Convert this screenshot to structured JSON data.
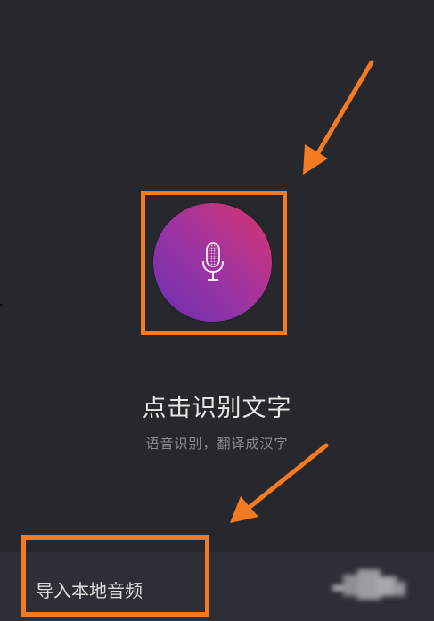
{
  "main": {
    "title": "点击识别文字",
    "subtitle": "语音识别，翻译成汉字"
  },
  "bottom_bar": {
    "import_label": "导入本地音频"
  },
  "icons": {
    "mic": "microphone-icon",
    "right_action": "blurred-icon"
  },
  "colors": {
    "background": "#26282d",
    "highlight": "#f47b21",
    "mic_gradient_start": "#6a2fb0",
    "mic_gradient_end": "#d8356e",
    "title_text": "#e6e6e6",
    "subtitle_text": "#8a8c92"
  }
}
